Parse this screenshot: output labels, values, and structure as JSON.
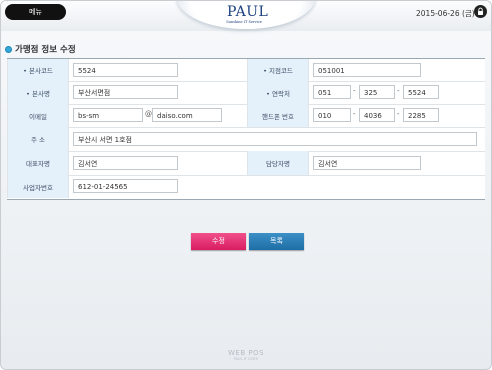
{
  "header": {
    "menu_label": "메뉴",
    "logo_text": "PAUL",
    "logo_sub": "Sunshine IT Service",
    "date": "2015-06-26 (금)",
    "lock_icon": "lock-icon"
  },
  "section": {
    "title": "가맹점 정보 수정"
  },
  "form": {
    "labels": {
      "hq_code": "• 본사코드",
      "branch_code": "• 지점코드",
      "hq_name": "• 본사명",
      "contact": "• 연락처",
      "email": "이메일",
      "mobile": "핸드폰 번호",
      "address": "주 소",
      "ceo": "대표자명",
      "manager": "담당자명",
      "biz_no": "사업자번호"
    },
    "values": {
      "hq_code": "5524",
      "branch_code": "051001",
      "hq_name": "부산서면점",
      "contact_1": "051",
      "contact_2": "325",
      "contact_3": "5524",
      "email_id": "bs-sm",
      "email_at": "@",
      "email_domain": "daiso.com",
      "mobile_1": "010",
      "mobile_2": "4036",
      "mobile_3": "2285",
      "address": "부산시 서면 1호점",
      "ceo": "김서연",
      "manager": "김서연",
      "biz_no": "612-01-24565"
    },
    "dash": "-"
  },
  "buttons": {
    "save": "수정",
    "list": "목록"
  },
  "footer": {
    "line1": "WEB POS",
    "line2": "PAUL IT CORP."
  },
  "colors": {
    "save_button": "#e12a6e",
    "list_button": "#2a7fb8",
    "label_bg": "#e5f1fa",
    "menu_button": "#111111"
  }
}
